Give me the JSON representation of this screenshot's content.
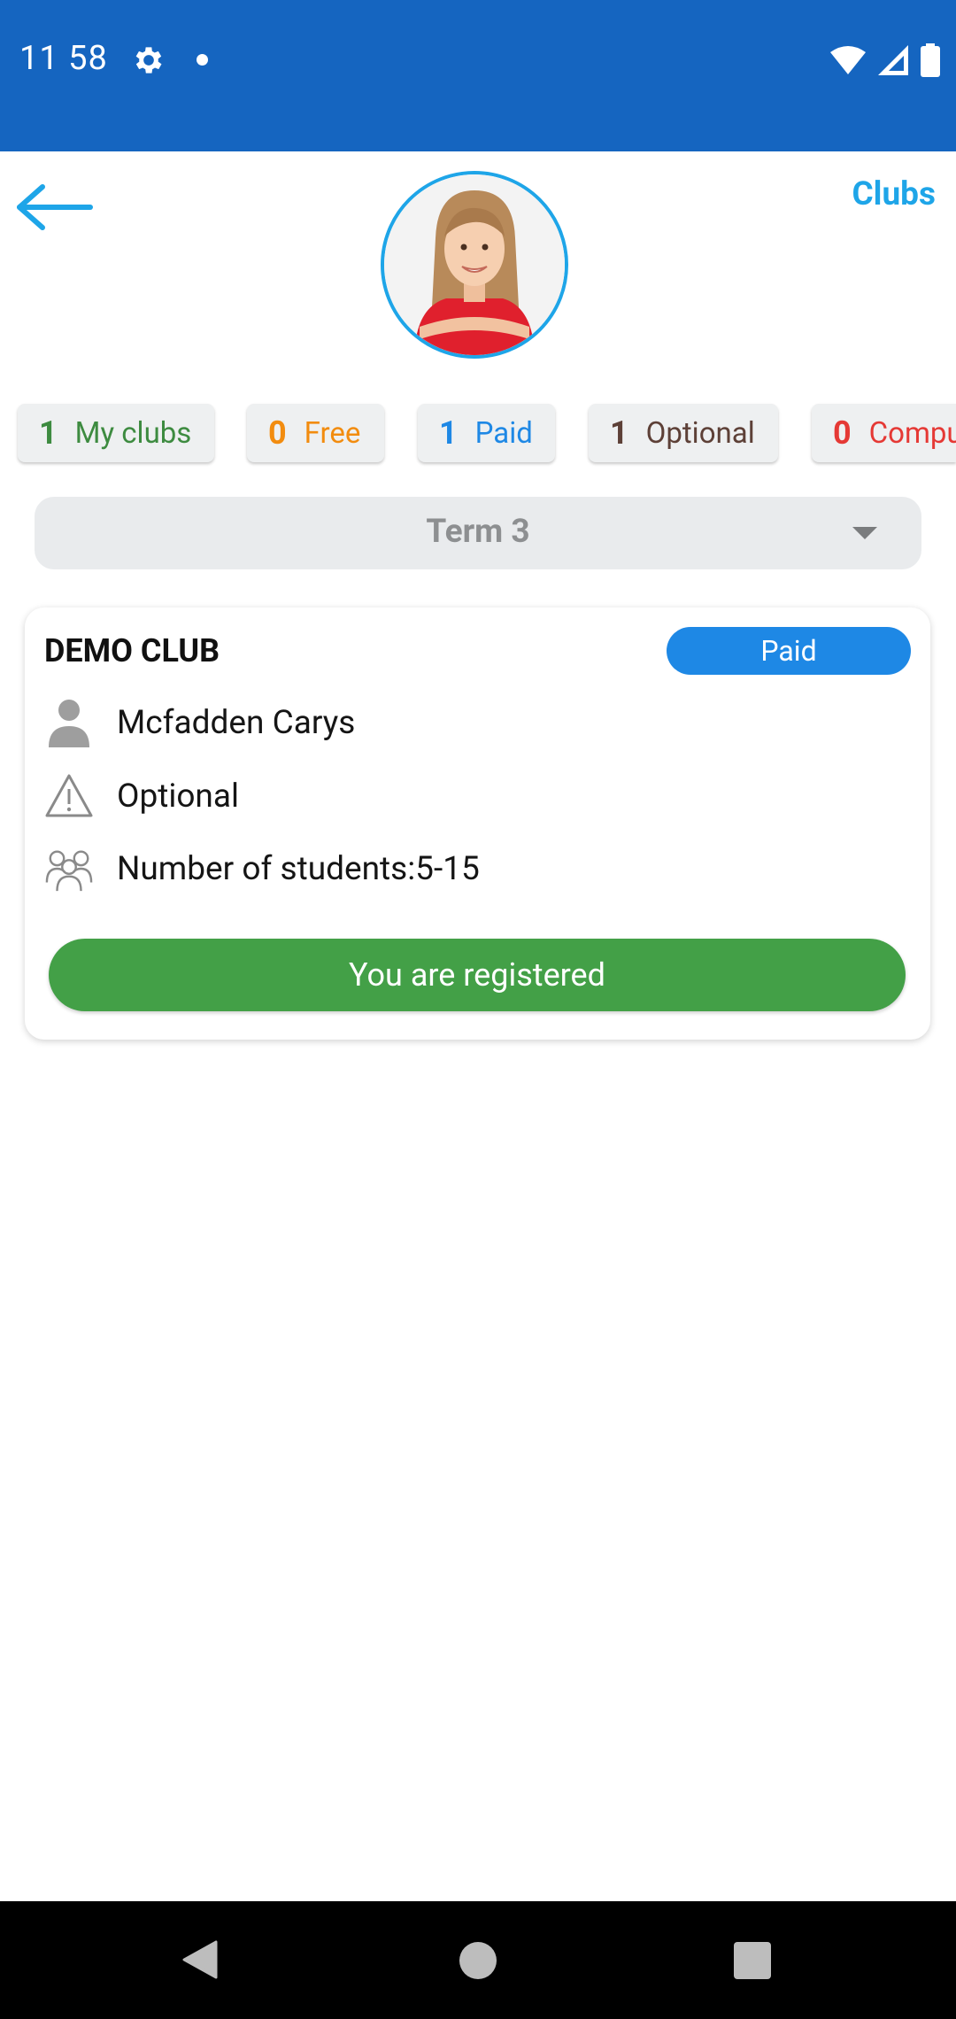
{
  "status_bar": {
    "time": "11 58",
    "icons": [
      "gear-icon",
      "notification-dot-icon",
      "wifi-icon",
      "cell-signal-icon",
      "battery-icon"
    ]
  },
  "header": {
    "back_icon": "arrow-left-icon",
    "clubs_link": "Clubs",
    "avatar_alt": "student avatar"
  },
  "chips": [
    {
      "count": "1",
      "label": "My clubs",
      "color": "#3d8b40"
    },
    {
      "count": "0",
      "label": "Free",
      "color": "#f28c0f"
    },
    {
      "count": "1",
      "label": "Paid",
      "color": "#1e88e5"
    },
    {
      "count": "1",
      "label": "Optional",
      "color": "#5d4037"
    },
    {
      "count": "0",
      "label": "Compu",
      "color": "#e53935"
    }
  ],
  "term_select": {
    "value": "Term 3"
  },
  "club_card": {
    "title": "DEMO CLUB",
    "badge": "Paid",
    "teacher": "Mcfadden Carys",
    "type": "Optional",
    "students": "Number of students:5-15",
    "button": "You are registered"
  },
  "colors": {
    "status_bar": "#1565c0",
    "accent": "#1ea5e8",
    "badge": "#1e88e5",
    "registered": "#43a047"
  }
}
